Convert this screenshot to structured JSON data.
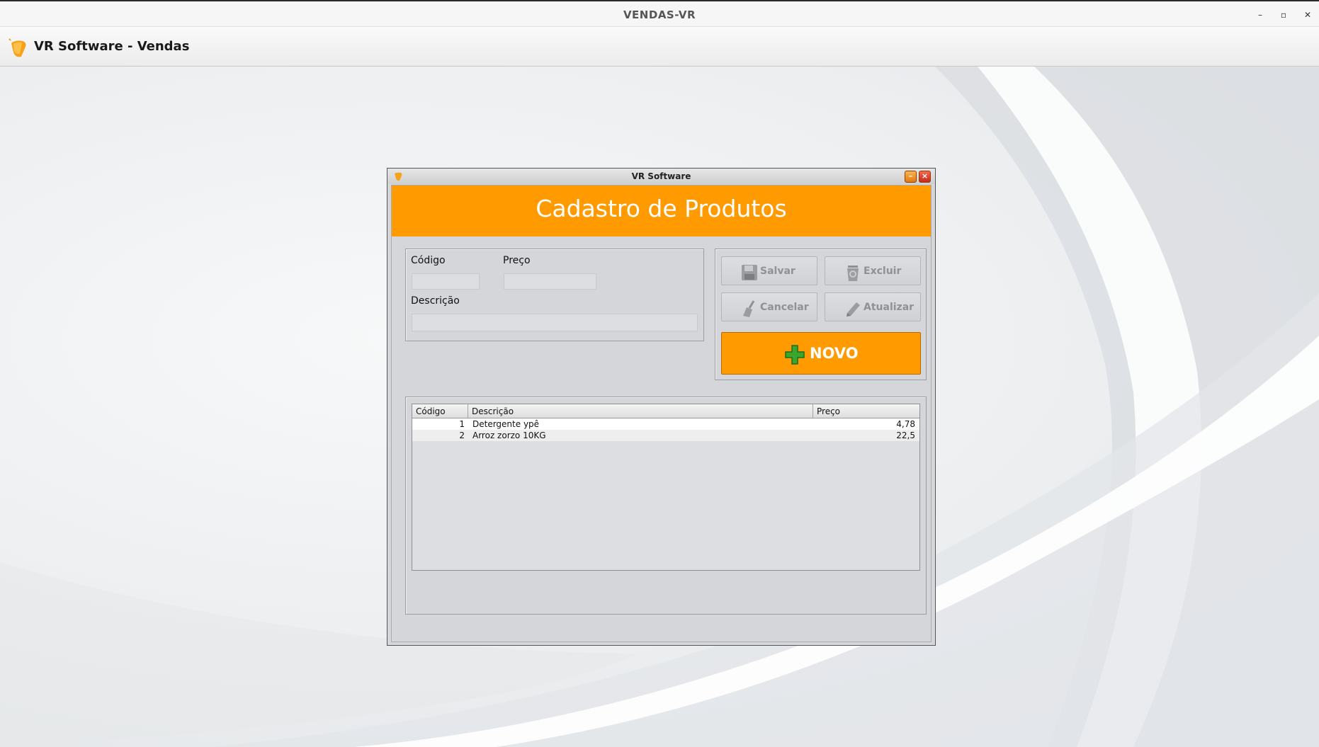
{
  "os_window": {
    "title": "VENDAS-VR",
    "controls": {
      "minimize": "–",
      "restore": "▫",
      "close": "✕"
    }
  },
  "app": {
    "title": "VR Software - Vendas"
  },
  "dialog": {
    "title": "VR Software",
    "banner_title": "Cadastro de Produtos",
    "form": {
      "codigo_label": "Código",
      "codigo_value": "",
      "preco_label": "Preço",
      "preco_value": "",
      "descricao_label": "Descrição",
      "descricao_value": ""
    },
    "buttons": {
      "salvar": "Salvar",
      "excluir": "Excluir",
      "cancelar": "Cancelar",
      "atualizar": "Atualizar",
      "novo": "NOVO"
    },
    "table": {
      "columns": [
        "Código",
        "Descrição",
        "Preço"
      ],
      "rows": [
        {
          "codigo": "1",
          "descricao": "Detergente ypê",
          "preco": "4,78"
        },
        {
          "codigo": "2",
          "descricao": "Arroz zorzo 10KG",
          "preco": "22,5"
        }
      ]
    }
  },
  "colors": {
    "accent_orange": "#ff9a00",
    "disabled_text": "#8f9194",
    "novo_icon_green": "#3aa630"
  }
}
